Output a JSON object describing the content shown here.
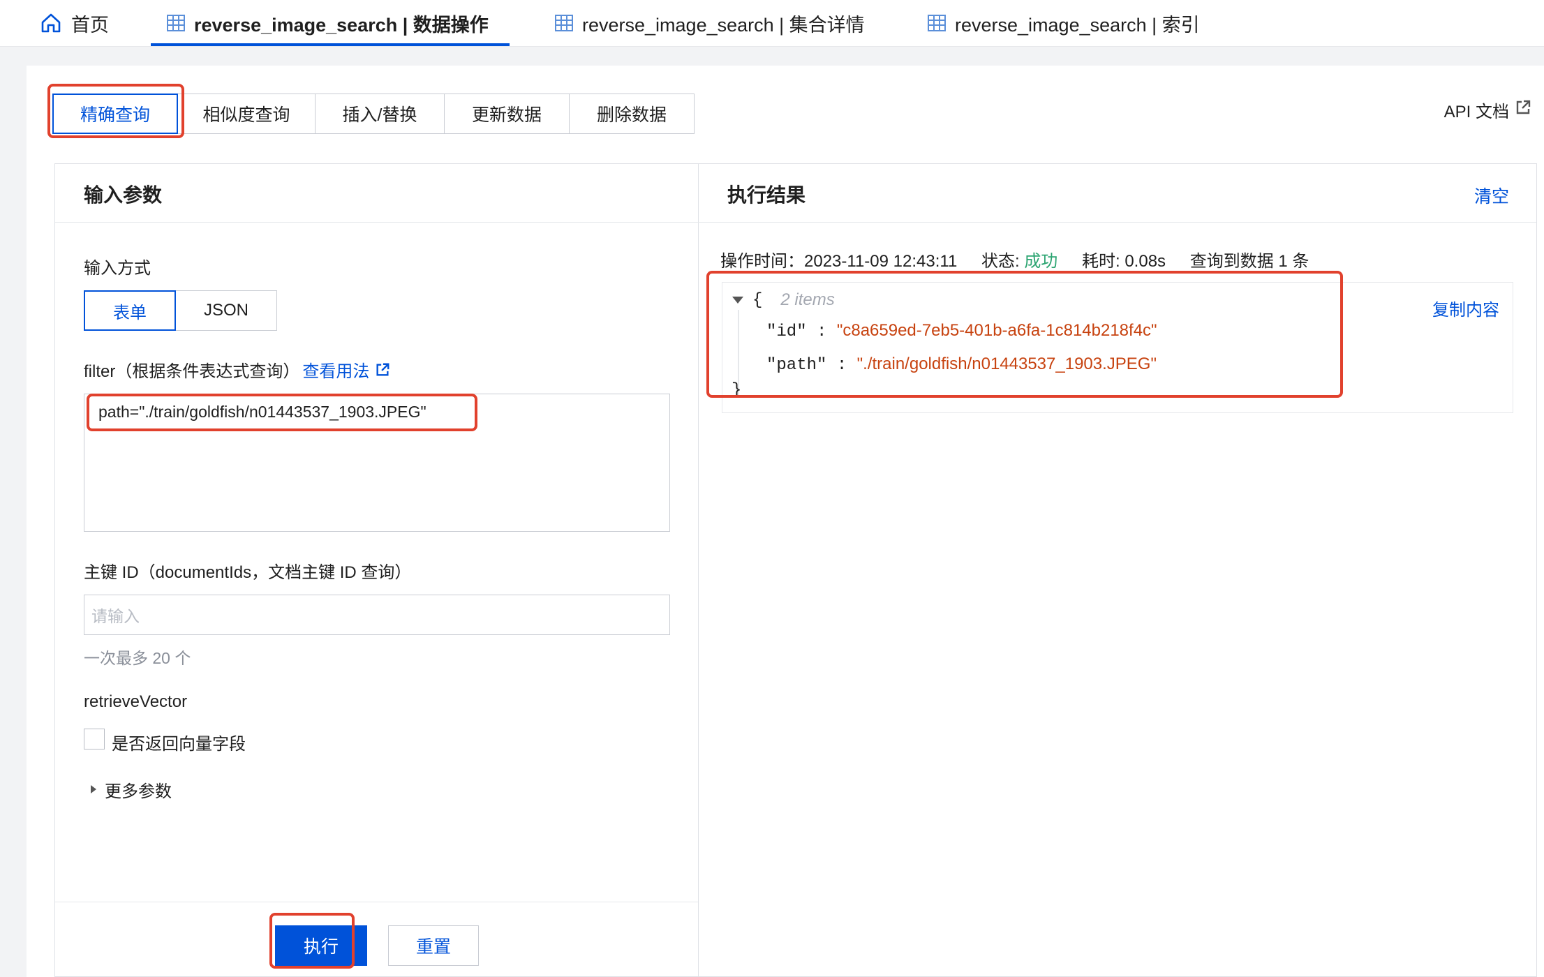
{
  "page_tabs": [
    {
      "label": "首页"
    },
    {
      "label": "reverse_image_search | 数据操作"
    },
    {
      "label": "reverse_image_search | 集合详情"
    },
    {
      "label": "reverse_image_search | 索引"
    }
  ],
  "operation_tabs": [
    "精确查询",
    "相似度查询",
    "插入/替换",
    "更新数据",
    "删除数据"
  ],
  "api_doc": "API 文档",
  "input_panel": {
    "title": "输入参数",
    "input_mode_label": "输入方式",
    "input_modes": [
      "表单",
      "JSON"
    ],
    "filter_label": "filter（根据条件表达式查询）",
    "filter_help_link": "查看用法",
    "filter_value": "path=\"./train/goldfish/n01443537_1903.JPEG\"",
    "doc_ids_label": "主键 ID（documentIds，文档主键 ID 查询）",
    "doc_ids_placeholder": "请输入",
    "doc_ids_hint": "一次最多 20 个",
    "retrieve_vector_label": "retrieveVector",
    "retrieve_vector_checkbox": "是否返回向量字段",
    "more_params": "更多参数",
    "execute_button": "执行",
    "reset_button": "重置"
  },
  "result_panel": {
    "title": "执行结果",
    "clear_link": "清空",
    "op_time_label": "操作时间：",
    "op_time_value": "2023-11-09 12:43:11",
    "status_label": "状态:",
    "status_value": "成功",
    "duration_label": "耗时:",
    "duration_value": "0.08s",
    "found_text": "查询到数据 1 条",
    "copy_link": "复制内容",
    "json": {
      "open_brace": "{",
      "item_count": "2 items",
      "close_brace": "}",
      "fields": [
        {
          "key": "\"id\"",
          "value": "\"c8a659ed-7eb5-401b-a6fa-1c814b218f4c\""
        },
        {
          "key": "\"path\"",
          "value": "\"./train/goldfish/n01443537_1903.JPEG\""
        }
      ]
    }
  },
  "colors": {
    "accent": "#0052d9",
    "success": "#2ba471",
    "json_string": "#c7420f",
    "highlight": "#e1412d"
  },
  "icons": [
    "home-icon",
    "table-icon",
    "external-link-icon",
    "caret-down-icon",
    "caret-right-icon"
  ]
}
